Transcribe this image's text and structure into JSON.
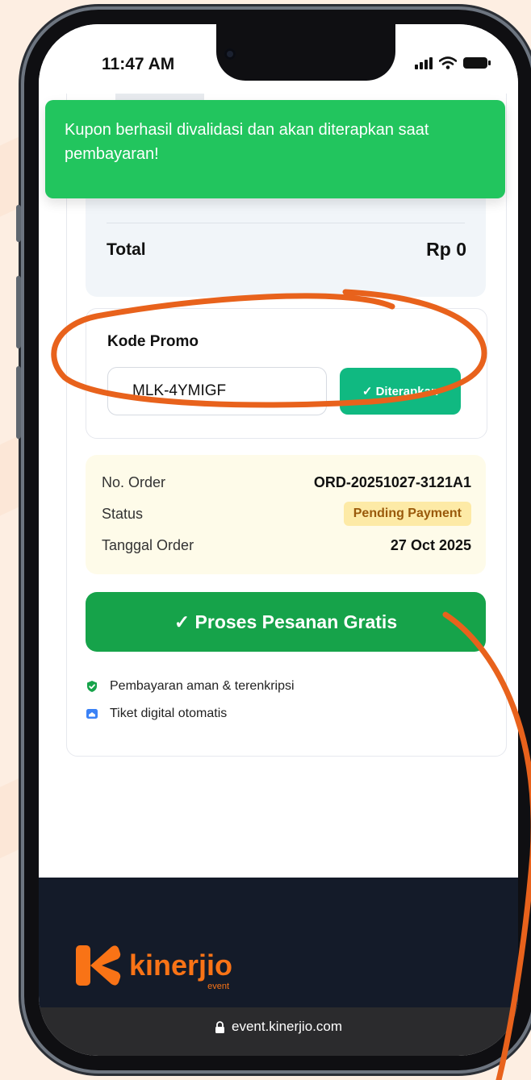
{
  "status_bar": {
    "time": "11:47 AM"
  },
  "toast": {
    "message": "Kupon berhasil divalidasi dan akan diterapkan saat pembayaran!"
  },
  "summary": {
    "total_label": "Total",
    "total_value": "Rp 0"
  },
  "promo": {
    "label": "Kode Promo",
    "code_value": "MLK-4YMIGF",
    "apply_button_label": "✓ Diterapkan"
  },
  "order": {
    "rows": [
      {
        "key": "No. Order",
        "value": "ORD-20251027-3121A1"
      },
      {
        "key": "Status",
        "value": "Pending Payment"
      },
      {
        "key": "Tanggal Order",
        "value": "27 Oct 2025"
      }
    ]
  },
  "cta": {
    "label": "✓ Proses Pesanan Gratis"
  },
  "features": [
    {
      "icon": "shield-check-icon",
      "text": "Pembayaran aman & terenkripsi"
    },
    {
      "icon": "ticket-icon",
      "text": "Tiket digital otomatis"
    }
  ],
  "footer": {
    "brand": "kinerjio",
    "brand_sub": "event"
  },
  "browser": {
    "url": "event.kinerjio.com"
  },
  "colors": {
    "accent_green": "#16a34a",
    "toast_green": "#22c55e",
    "button_teal": "#10b981",
    "annotation_orange": "#e8621c",
    "brand_orange": "#f97316"
  }
}
